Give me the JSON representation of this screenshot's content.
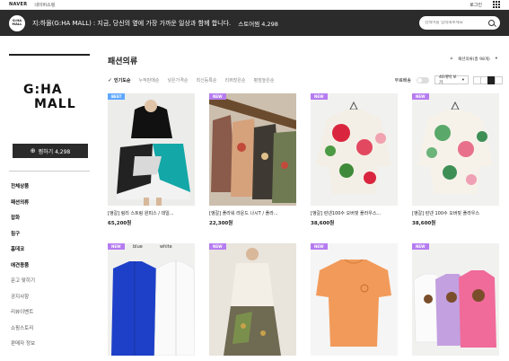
{
  "topbar": {
    "naver": "NAVER",
    "shopping": "네이버쇼핑",
    "login": "로그인"
  },
  "header": {
    "logo": "G:HA MALL",
    "store_title": "지:하몰(G:HA MALL)",
    "tagline": ": 지금, 당신의 옆에 가장 가까운 일상과 함께 합니다.",
    "store_zzim": "스토어찜 4,298",
    "search_placeholder": "검색어를 입력해보세요"
  },
  "sidebar": {
    "brand_line1": "G:HA",
    "brand_line2": "MALL",
    "follow_label": "찜하기 4,298",
    "menu": [
      "전체상품",
      "패션의류",
      "잡화",
      "침구",
      "홈데코",
      "애견용품",
      "문고 맞히기",
      "공지사항",
      "리뷰이벤트",
      "쇼핑스토리",
      "판매자 정보"
    ]
  },
  "main": {
    "title": "패션의류",
    "category_label": "패션의류(총 98개)",
    "sort_options": [
      "인기도순",
      "누적판매순",
      "낮은가격순",
      "최신등록순",
      "리뷰많은순",
      "평점높은순"
    ],
    "free_shipping": "무료배송",
    "per_page": "40개씩 보기"
  },
  "products": [
    {
      "badge": "BEST",
      "name": "[앵갈] 링리 스트링 원피스 / 데일...",
      "price": "65,200원"
    },
    {
      "badge": "NEW",
      "name": "[앵갈] 플라워 라운드 나시T / 플라...",
      "price": "22,300원"
    },
    {
      "badge": "NEW",
      "name": "[앵갈] 린넨100수 오버핏 플라우스...",
      "price": "38,600원"
    },
    {
      "badge": "NEW",
      "name": "[앵갈] 린넨 100수 오버핏 플라우스",
      "price": "38,600원"
    },
    {
      "badge": "NEW",
      "name": "",
      "price": ""
    },
    {
      "badge": "NEW",
      "name": "",
      "price": ""
    },
    {
      "badge": "NEW",
      "name": "",
      "price": ""
    },
    {
      "badge": "NEW",
      "name": "",
      "price": ""
    }
  ],
  "row2_labels": {
    "blue": "blue",
    "white": "white"
  }
}
